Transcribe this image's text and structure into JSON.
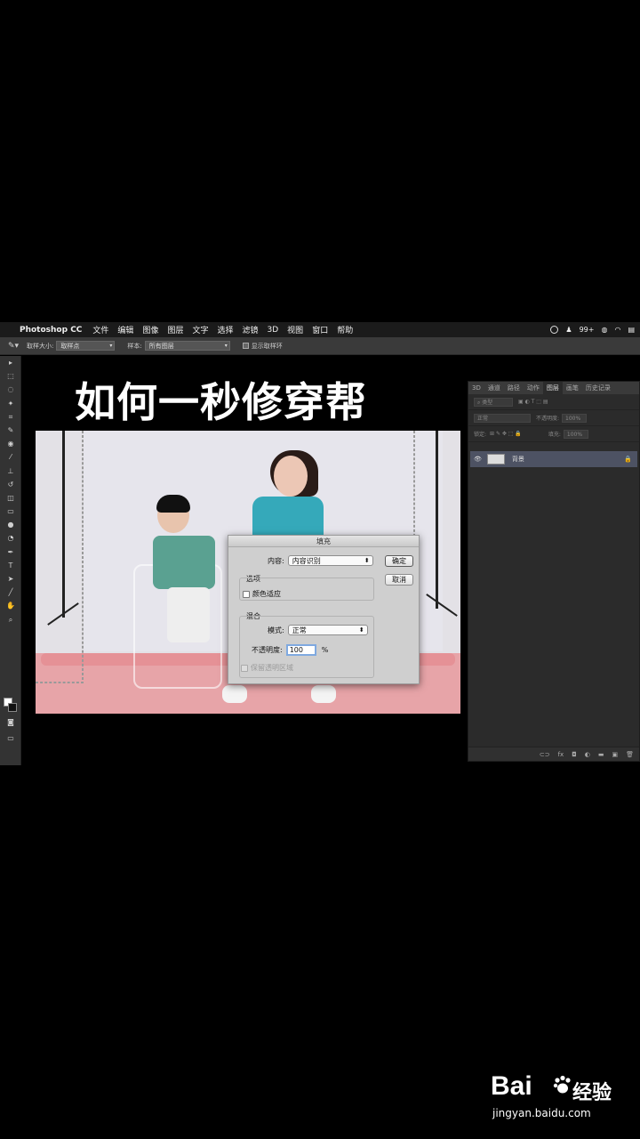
{
  "menubar": {
    "app_name": "Photoshop CC",
    "items": [
      "文件",
      "编辑",
      "图像",
      "图层",
      "文字",
      "选择",
      "滤镜",
      "3D",
      "视图",
      "窗口",
      "帮助"
    ],
    "status_badge": "99+"
  },
  "options_bar": {
    "sample_size_label": "取样大小:",
    "sample_size_value": "取样点",
    "sample_label": "样本:",
    "sample_value": "所有图层",
    "show_ring_label": "显示取样环"
  },
  "headline": "如何一秒修穿帮",
  "dialog": {
    "title": "填充",
    "content_label": "内容:",
    "content_value": "内容识别",
    "options_label": "选项",
    "color_adapt_label": "颜色适应",
    "blend_label": "混合",
    "mode_label": "模式:",
    "mode_value": "正常",
    "opacity_label": "不透明度:",
    "opacity_value": "100",
    "opacity_unit": "%",
    "preserve_label": "保留透明区域",
    "ok_label": "确定",
    "cancel_label": "取消"
  },
  "layers_panel": {
    "tabs": [
      "3D",
      "通道",
      "路径",
      "动作",
      "图层",
      "画笔",
      "历史记录"
    ],
    "active_tab": "图层",
    "filter_label": "类型",
    "blend_value": "正常",
    "opacity_label": "不透明度:",
    "opacity_value": "100%",
    "lock_label": "锁定:",
    "fill_label": "填充:",
    "fill_value": "100%",
    "layer_name": "背景"
  },
  "watermark": {
    "brand": "Bai",
    "brand_suffix": "经验",
    "url": "jingyan.baidu.com"
  },
  "colors": {
    "menubar_bg": "#1b1b1b",
    "panel_bg": "#2b2b2b",
    "layer_selected": "#4d5263",
    "dialog_bg": "#cfcfcf",
    "focus_ring": "#7fa9e0"
  }
}
